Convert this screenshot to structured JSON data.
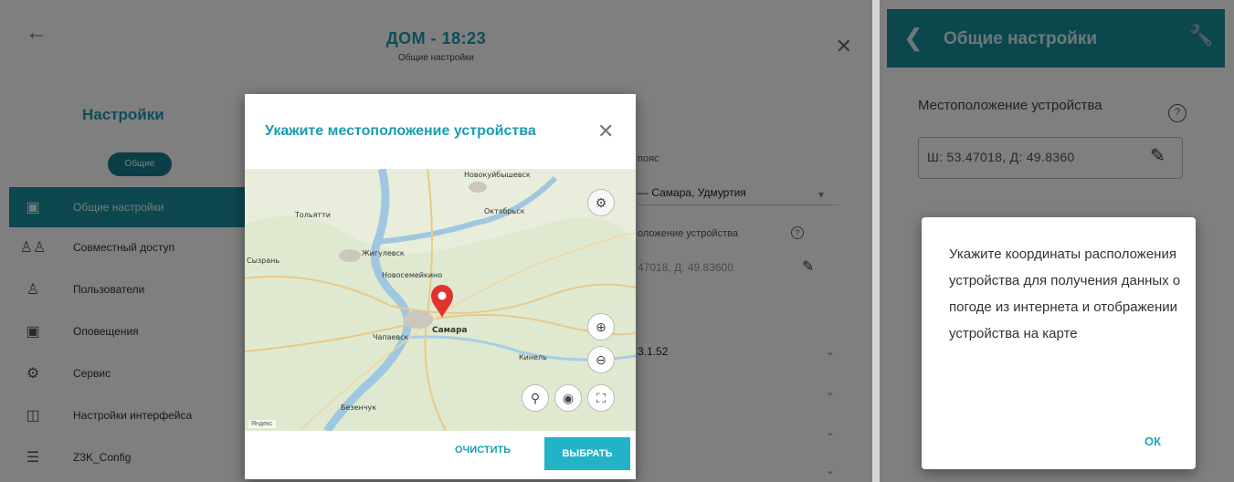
{
  "left": {
    "header": {
      "back_icon": "arrow-left-icon",
      "title": "ДОМ - 18:23",
      "subtitle": "Общие настройки",
      "close_icon": "close-icon"
    },
    "sidebar": {
      "title": "Настройки",
      "chip": "Общие",
      "items": [
        {
          "label": "Общие настройки",
          "icon": "home-icon",
          "active": true
        },
        {
          "label": "Совместный доступ",
          "icon": "shared-users-icon",
          "active": false
        },
        {
          "label": "Пользователи",
          "icon": "users-icon",
          "active": false
        },
        {
          "label": "Оповещения",
          "icon": "notification-icon",
          "active": false
        },
        {
          "label": "Сервис",
          "icon": "service-icon",
          "active": false
        },
        {
          "label": "Настройки интерфейса",
          "icon": "interface-settings-icon",
          "active": false
        },
        {
          "label": "Z3K_Config",
          "icon": "list-icon",
          "active": false
        }
      ]
    },
    "form": {
      "timezone_label": "пояс",
      "timezone_value": "— Самара, Удмуртия",
      "location_label": "оложение устройства",
      "location_value": "47018, Д. 49.83600",
      "version_value": "3.1.52"
    },
    "dialog": {
      "title": "Укажите местоположение устройства",
      "close_icon": "close-icon",
      "map": {
        "cities": [
          "Новокуйбышевск",
          "Тольятти",
          "Самара",
          "Жигулевск",
          "Сызрань",
          "Октябрьск",
          "Новосемейкино",
          "Чапаевск",
          "Кинель",
          "Безенчук"
        ],
        "marker_label": "Самара",
        "attribution": "Яндекс",
        "controls": [
          "settings-icon",
          "zoom-in-icon",
          "zoom-out-icon",
          "search-icon",
          "locate-icon",
          "fullscreen-icon"
        ]
      },
      "clear_label": "ОЧИСТИТЬ",
      "choose_label": "ВЫБРАТЬ"
    }
  },
  "right": {
    "appbar": {
      "back_icon": "chevron-left-icon",
      "title": "Общие настройки",
      "tool_icon": "wrench-icon"
    },
    "location_label": "Местоположение устройства",
    "help_icon": "help-icon",
    "coordinates": "Ш: 53.47018, Д: 49.8360",
    "edit_icon": "edit-icon",
    "alert": {
      "text": "Укажите координаты расположения устройства для получения данных о погоде из интернета и отображении устройства на карте",
      "ok_label": "ОК"
    }
  },
  "colors": {
    "accent": "#1a9bb1",
    "appbar": "#1b8f9c",
    "button": "#22b4c6",
    "tool": "#f0b43a"
  }
}
